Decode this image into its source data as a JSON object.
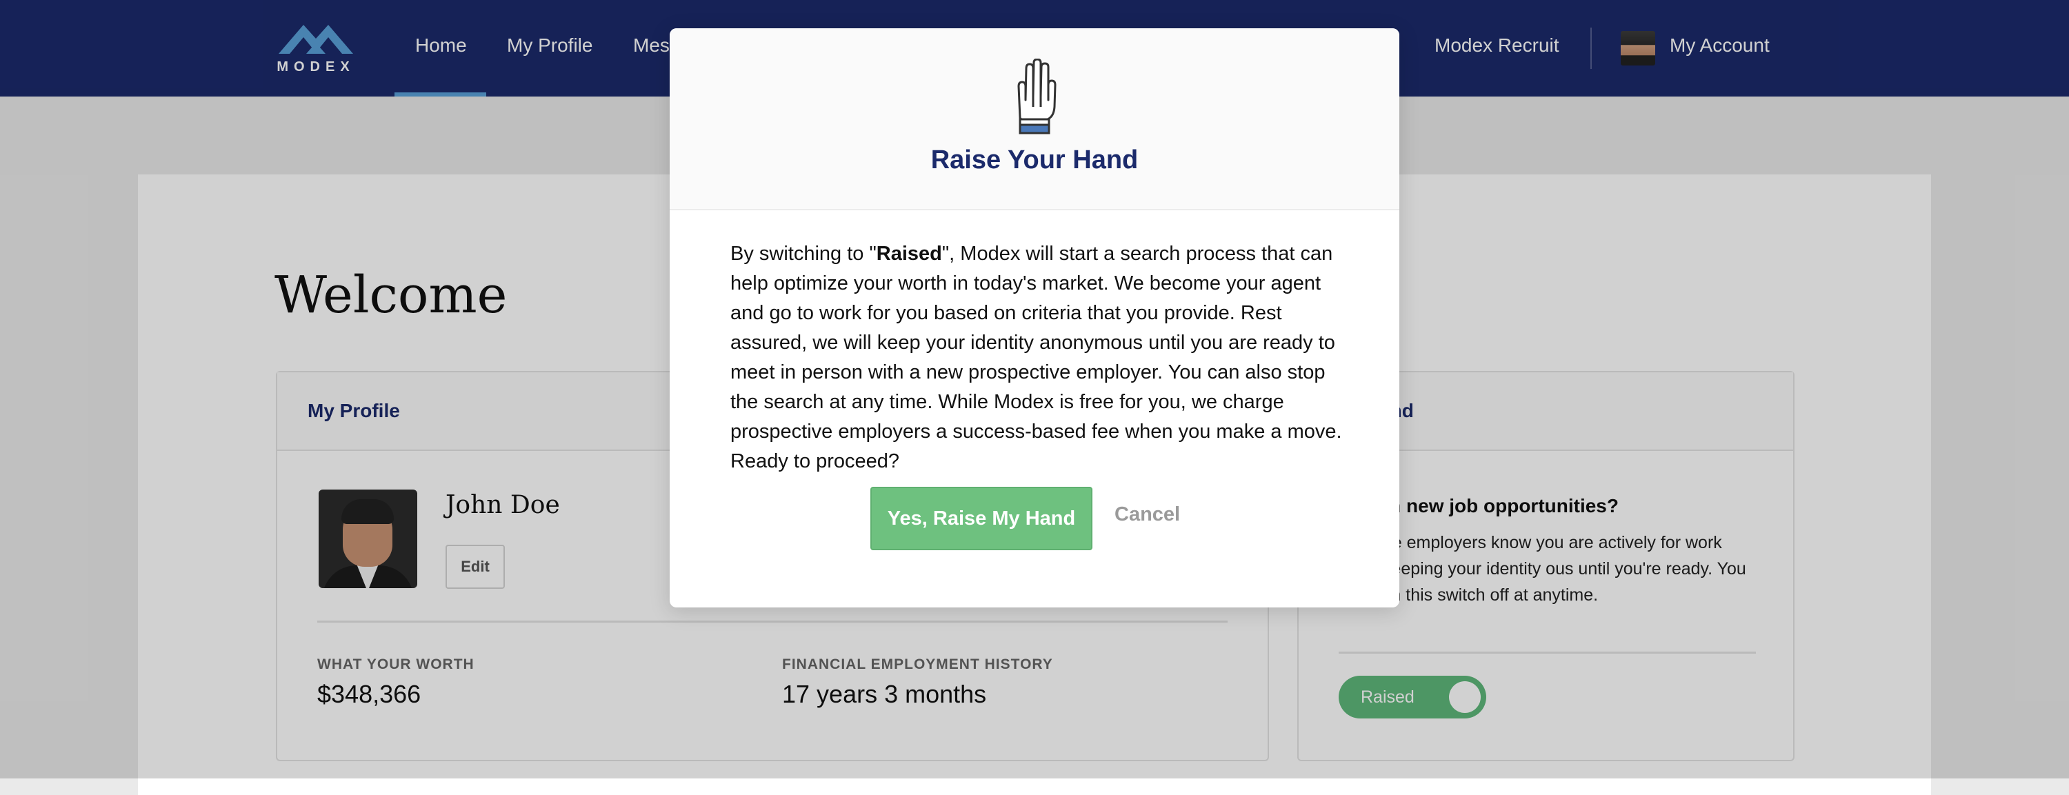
{
  "nav": {
    "logo_text": "MODEX",
    "items": [
      "Home",
      "My Profile",
      "Mes",
      "Modex Recruit"
    ],
    "account_label": "My Account"
  },
  "page": {
    "welcome": "Welcome"
  },
  "profile_panel": {
    "title": "My Profile",
    "name": "John Doe",
    "edit_label": "Edit",
    "worth_label": "WHAT YOUR WORTH",
    "worth_value": "$348,366",
    "history_label": "FINANCIAL EMPLOYMENT HISTORY",
    "history_value": "17 years 3 months"
  },
  "raise_panel": {
    "title": "our Hand",
    "question": "sted in new job opportunities?",
    "description": "spective employers know you are actively for work while keeping your identity ous until you're ready. You can turn this switch off at anytime.",
    "toggle_label": "Raised",
    "toggle_on": true
  },
  "modal": {
    "title": "Raise Your Hand",
    "body_pre": "By switching to \"",
    "body_bold": "Raised",
    "body_post": "\", Modex will start a search process that can help optimize your worth in today's market. We become your agent and go to work for you based on criteria that you provide. Rest assured, we will keep your identity anonymous until you are ready to meet in person with a new prospective employer. You can also stop the search at any time. While Modex is free for you, we charge prospective employers a success-based fee when you make a move. Ready to proceed?",
    "confirm_label": "Yes, Raise My Hand",
    "cancel_label": "Cancel"
  },
  "colors": {
    "nav_bg": "#1b2a6b",
    "accent_green": "#6ec17f",
    "title_navy": "#1b2a6b"
  },
  "icons": [
    "modex-logo-icon",
    "hand-icon",
    "avatar"
  ]
}
